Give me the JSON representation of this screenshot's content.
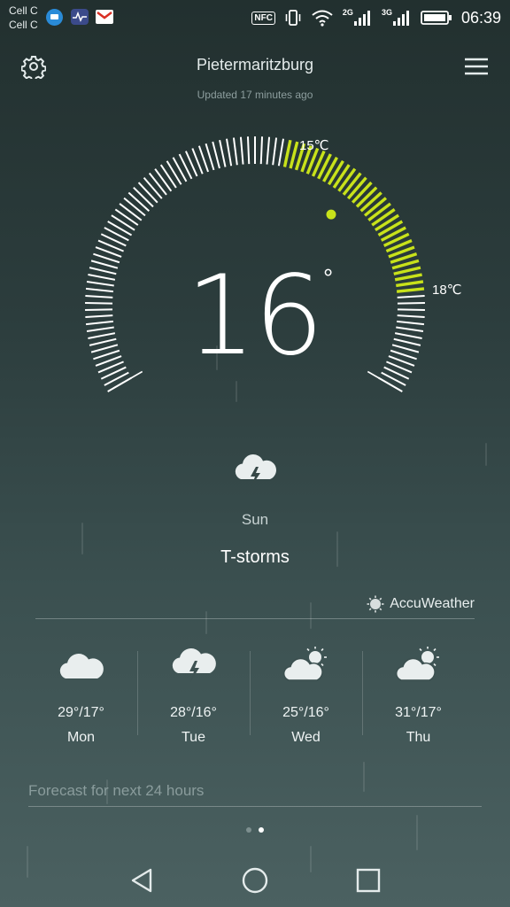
{
  "status_bar": {
    "carriers": [
      "Cell C",
      "Cell C"
    ],
    "network_2g": "2G",
    "network_3g": "3G",
    "nfc_label": "NFC",
    "time": "06:39",
    "notification_icons": [
      "message-icon",
      "health-app-icon",
      "gmail-icon"
    ]
  },
  "header": {
    "city": "Pietermaritzburg",
    "updated": "Updated 17 minutes ago",
    "left_icon": "settings-gear-icon",
    "right_icon": "menu-icon"
  },
  "current": {
    "temperature": "16",
    "degree_symbol": "°",
    "low_label": "15℃",
    "high_label": "18℃",
    "day": "Sun",
    "condition": "T-storms",
    "condition_icon": "thunderstorm-cloud-icon"
  },
  "provider": {
    "name": "AccuWeather",
    "icon": "accuweather-sun-icon"
  },
  "forecast": [
    {
      "day": "Mon",
      "range": "29°/17°",
      "icon": "cloud-icon"
    },
    {
      "day": "Tue",
      "range": "28°/16°",
      "icon": "thunderstorm-cloud-icon"
    },
    {
      "day": "Wed",
      "range": "25°/16°",
      "icon": "partly-cloudy-icon"
    },
    {
      "day": "Thu",
      "range": "31°/17°",
      "icon": "partly-cloudy-icon"
    }
  ],
  "hourly": {
    "label": "Forecast for next 24 hours"
  },
  "pager": {
    "pages": 2,
    "active_index": 1
  },
  "colors": {
    "accent": "#c8e21a",
    "tick": "#ffffff",
    "dot_inactive": "#7d8f8f",
    "dot_active": "#ffffff"
  },
  "nav": {
    "back_icon": "back-triangle-icon",
    "home_icon": "home-circle-icon",
    "recents_icon": "recents-square-icon"
  }
}
